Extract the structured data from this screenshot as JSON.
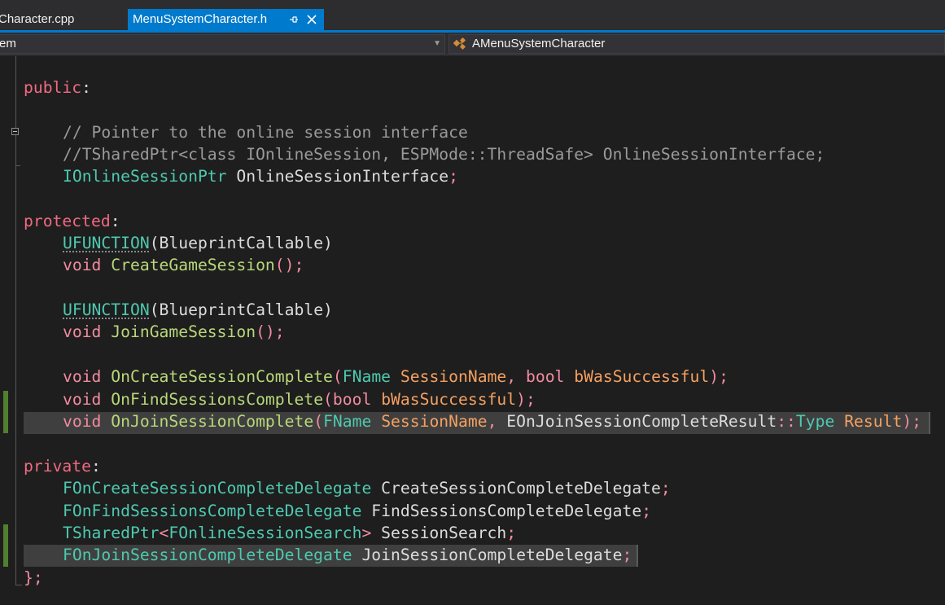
{
  "tabs": [
    {
      "label": "Character.cpp",
      "active": false
    },
    {
      "label": "MenuSystemCharacter.h",
      "active": true
    }
  ],
  "tab_icons": {
    "pin": "pin-icon",
    "close": "close-icon"
  },
  "nav": {
    "left_dropdown_text": "em",
    "right_dropdown_text": "AMenuSystemCharacter",
    "right_icon": "class-icon"
  },
  "colors": {
    "accent": "#007acc",
    "background": "#1e1e1e",
    "change_bar": "#4f7f2f",
    "access_specifier": "#f06a82",
    "function": "#b8d77a",
    "type": "#4ec9b0",
    "parameter": "#f5a060",
    "comment": "#9a9a9a"
  },
  "code": {
    "l01": {
      "a": "public",
      "b": ":"
    },
    "l03": {
      "a": "// Pointer to the online session interface"
    },
    "l04": {
      "a": "//TSharedPtr<class IOnlineSession, ESPMode::ThreadSafe> OnlineSessionInterface;"
    },
    "l05": {
      "a": "IOnlineSessionPtr",
      "b": " OnlineSessionInterface",
      "c": ";"
    },
    "l07": {
      "a": "protected",
      "b": ":"
    },
    "l08": {
      "a": "UFUNCTION",
      "b": "(",
      "c": "BlueprintCallable",
      "d": ")"
    },
    "l09": {
      "a": "void",
      "b": " ",
      "c": "CreateGameSession",
      "d": "();"
    },
    "l11": {
      "a": "UFUNCTION",
      "b": "(",
      "c": "BlueprintCallable",
      "d": ")"
    },
    "l12": {
      "a": "void",
      "b": " ",
      "c": "JoinGameSession",
      "d": "();"
    },
    "l14": {
      "a": "void",
      "b": " ",
      "c": "OnCreateSessionComplete",
      "d": "(",
      "e": "FName",
      "f": " ",
      "g": "SessionName",
      "h": ", ",
      "i": "bool",
      "j": " ",
      "k": "bWasSuccessful",
      "l": ");"
    },
    "l15": {
      "a": "void",
      "b": " ",
      "c": "OnFindSessionsComplete",
      "d": "(",
      "e": "bool",
      "f": " ",
      "g": "bWasSuccessful",
      "h": ");"
    },
    "l16": {
      "a": "void",
      "b": " ",
      "c": "OnJoinSessionComplete",
      "d": "(",
      "e": "FName",
      "f": " ",
      "g": "SessionName",
      "h": ", ",
      "i": "EOnJoinSessionCompleteResult",
      "j": "::",
      "k": "Type",
      "l": " ",
      "m": "Result",
      "n": ");"
    },
    "l18": {
      "a": "private",
      "b": ":"
    },
    "l19": {
      "a": "FOnCreateSessionCompleteDelegate",
      "b": " CreateSessionCompleteDelegate",
      "c": ";"
    },
    "l20": {
      "a": "FOnFindSessionsCompleteDelegate",
      "b": " FindSessionsCompleteDelegate",
      "c": ";"
    },
    "l21": {
      "a": "TSharedPtr",
      "b": "<",
      "c": "FOnlineSessionSearch",
      "d": ">",
      "e": " SessionSearch",
      "f": ";"
    },
    "l22": {
      "a": "FOnJoinSessionCompleteDelegate",
      "b": " JoinSessionCompleteDelegate",
      "c": ";"
    },
    "l23": {
      "a": "};"
    }
  }
}
